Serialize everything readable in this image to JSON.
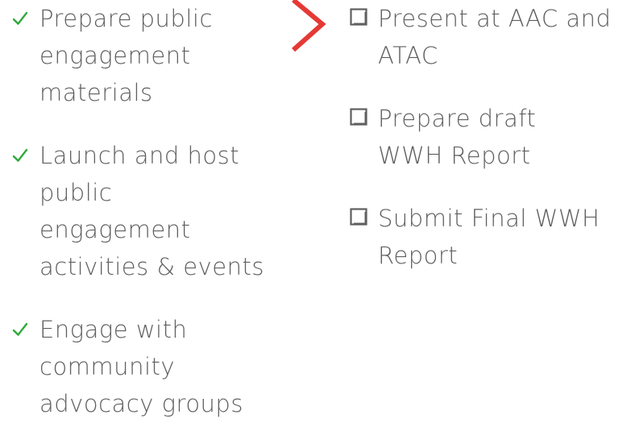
{
  "completed": {
    "items": [
      {
        "lines": [
          "Prepare public",
          "engagement",
          "materials"
        ]
      },
      {
        "lines": [
          "Launch and host",
          "public",
          "engagement",
          "activities & events"
        ]
      },
      {
        "lines": [
          "Engage with",
          "community",
          "advocacy groups"
        ]
      }
    ],
    "icon": "check-icon",
    "icon_color": "#2eaa3a"
  },
  "upcoming": {
    "items": [
      {
        "lines": [
          "Present at AAC and",
          "ATAC"
        ]
      },
      {
        "lines": [
          "Prepare draft",
          "WWH Report"
        ]
      },
      {
        "lines": [
          "Submit Final WWH",
          "Report"
        ]
      }
    ],
    "icon": "checkbox-empty-icon"
  },
  "divider": {
    "icon": "chevron-right-icon",
    "color": "#e53935"
  },
  "text_color": "#5f5f5f"
}
